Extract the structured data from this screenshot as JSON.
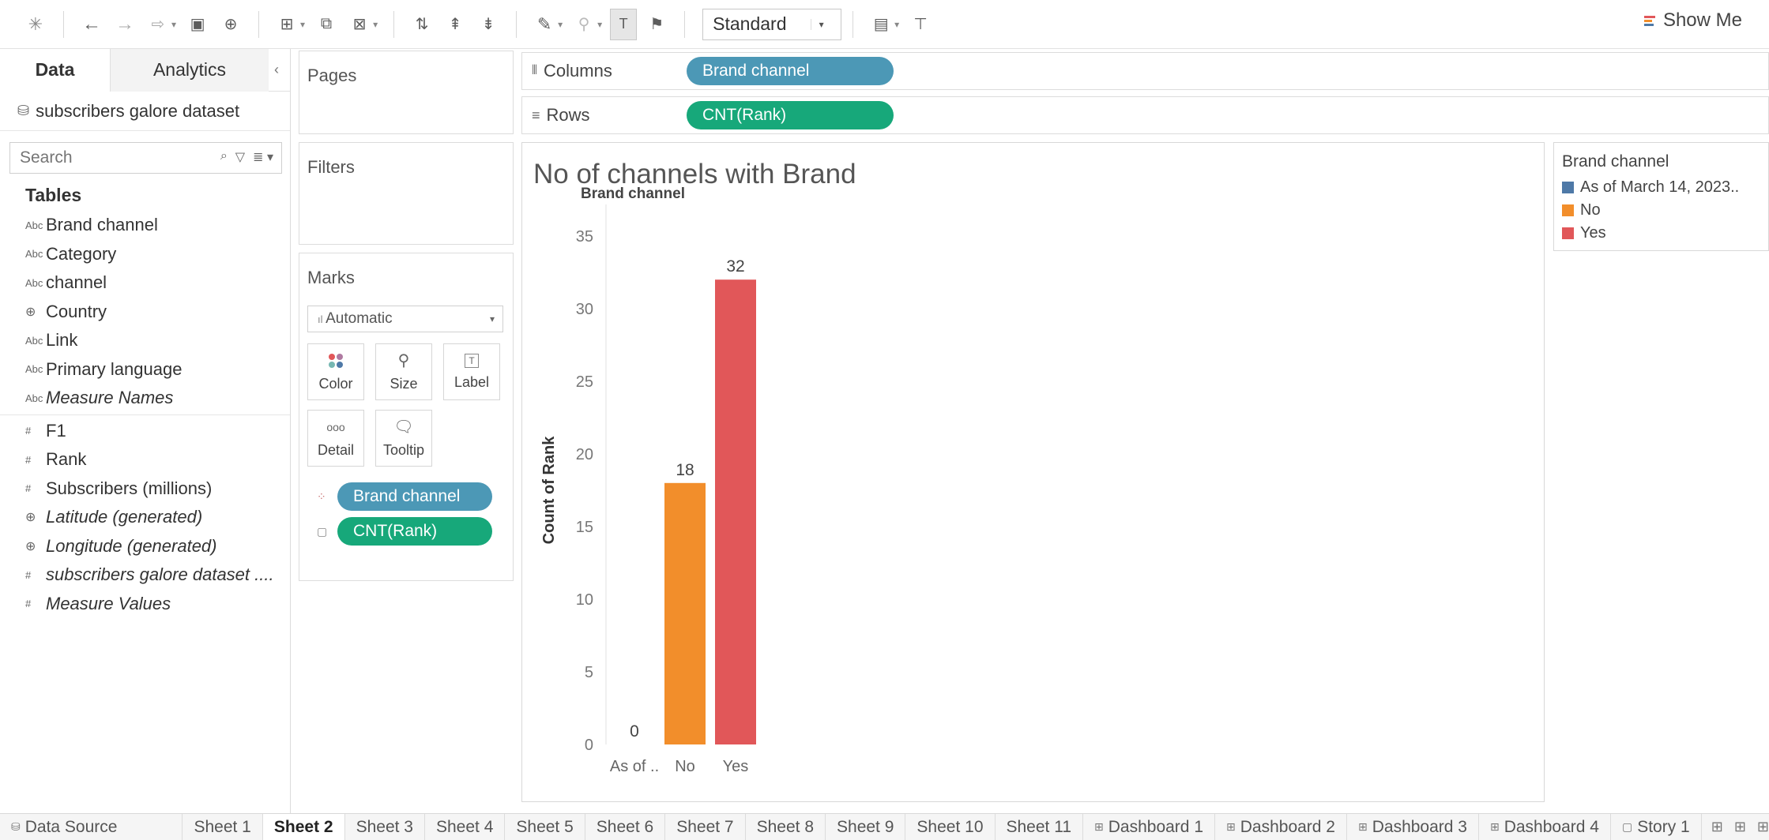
{
  "toolbar": {
    "icons": [
      "tableau-logo-icon",
      "undo-icon",
      "redo-icon",
      "redo-history-icon",
      "save-icon",
      "new-datasource-icon",
      "new-worksheet-icon",
      "duplicate-icon",
      "clear-sheet-icon",
      "swap-icon",
      "sort-ascending-icon",
      "sort-descending-icon",
      "highlight-icon",
      "group-icon",
      "show-labels-icon",
      "pin-icon",
      "show-cards-icon",
      "presentation-icon"
    ],
    "fit_select": "Standard",
    "show_me_label": "Show Me"
  },
  "data_pane": {
    "tabs": [
      "Data",
      "Analytics"
    ],
    "datasource": "subscribers galore dataset",
    "search_placeholder": "Search",
    "tables_heading": "Tables",
    "dimensions": [
      {
        "icon": "Abc",
        "name": "Brand channel",
        "italic": false
      },
      {
        "icon": "Abc",
        "name": "Category",
        "italic": false
      },
      {
        "icon": "Abc",
        "name": "channel",
        "italic": false
      },
      {
        "icon": "globe",
        "name": "Country",
        "italic": false
      },
      {
        "icon": "Abc",
        "name": "Link",
        "italic": false
      },
      {
        "icon": "Abc",
        "name": "Primary language",
        "italic": false
      },
      {
        "icon": "Abc",
        "name": "Measure Names",
        "italic": true
      }
    ],
    "measures": [
      {
        "icon": "#",
        "name": "F1",
        "italic": false
      },
      {
        "icon": "#",
        "name": "Rank",
        "italic": false
      },
      {
        "icon": "#",
        "name": "Subscribers (millions)",
        "italic": false
      },
      {
        "icon": "globe",
        "name": "Latitude (generated)",
        "italic": true
      },
      {
        "icon": "globe",
        "name": "Longitude (generated)",
        "italic": true
      },
      {
        "icon": "#",
        "name": "subscribers galore dataset ....",
        "italic": true
      },
      {
        "icon": "#",
        "name": "Measure Values",
        "italic": true
      }
    ]
  },
  "cards": {
    "pages": "Pages",
    "filters": "Filters",
    "marks": "Marks",
    "mark_type": "Automatic",
    "mark_buttons": [
      "Color",
      "Size",
      "Label",
      "Detail",
      "Tooltip"
    ],
    "mark_pills": [
      "Brand channel",
      "CNT(Rank)"
    ]
  },
  "shelves": {
    "columns_label": "Columns",
    "columns_pill": "Brand channel",
    "rows_label": "Rows",
    "rows_pill": "CNT(Rank)"
  },
  "view": {
    "title": "No of channels with Brand"
  },
  "legend": {
    "title": "Brand channel",
    "items": [
      {
        "label": "As of March 14, 2023..",
        "color": "#4e79a7"
      },
      {
        "label": "No",
        "color": "#f28e2b"
      },
      {
        "label": "Yes",
        "color": "#e15759"
      }
    ]
  },
  "chart_data": {
    "type": "bar",
    "header": "Brand channel",
    "categories": [
      "As of ..",
      "No",
      "Yes"
    ],
    "values": [
      0,
      18,
      32
    ],
    "data_labels": [
      "0",
      "18",
      "32"
    ],
    "colors": [
      "#4e79a7",
      "#f28e2b",
      "#e15759"
    ],
    "ylabel": "Count of Rank",
    "xlabel": "",
    "ylim": [
      0,
      35
    ],
    "yticks": [
      0,
      5,
      10,
      15,
      20,
      25,
      30,
      35
    ],
    "grid": false
  },
  "sheet_tabs": [
    "Data Source",
    "Sheet 1",
    "Sheet 2",
    "Sheet 3",
    "Sheet 4",
    "Sheet 5",
    "Sheet 6",
    "Sheet 7",
    "Sheet 8",
    "Sheet 9",
    "Sheet 10",
    "Sheet 11",
    "Dashboard 1",
    "Dashboard 2",
    "Dashboard 3",
    "Dashboard 4",
    "Story 1"
  ],
  "active_sheet": "Sheet 2"
}
